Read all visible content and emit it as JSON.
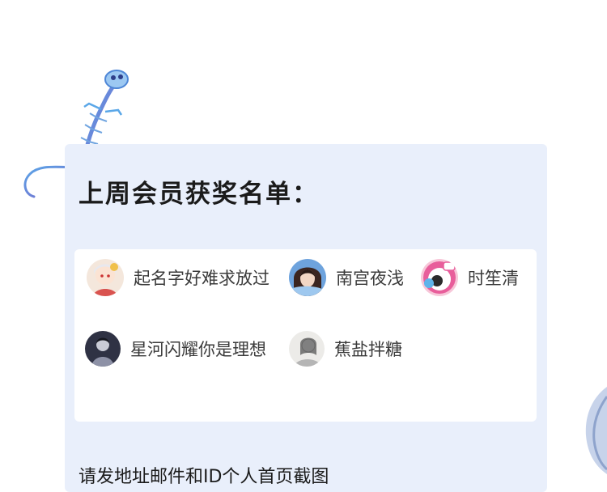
{
  "announcement": {
    "title": "上周会员获奖名单：",
    "winners": [
      {
        "name": "起名字好难求放过",
        "avatar_icon": "anime-girl-avatar-icon"
      },
      {
        "name": "南宫夜浅",
        "avatar_icon": "anime-character-avatar-icon"
      },
      {
        "name": "时笙清",
        "avatar_icon": "cartoon-avatar-icon"
      },
      {
        "name": "星河闪耀你是理想",
        "avatar_icon": "dark-portrait-avatar-icon"
      },
      {
        "name": "蕉盐拌糖",
        "avatar_icon": "sketch-portrait-avatar-icon"
      }
    ],
    "footer_text": "请发地址邮件和ID个人首页截图"
  },
  "colors": {
    "card_background": "#e9effb",
    "panel_background": "#ffffff",
    "title_text": "#1b1b1b",
    "name_text": "#3a3a3a"
  },
  "decorations": [
    "crystal-lizard-skeleton-icon",
    "blue-feather-icon"
  ]
}
